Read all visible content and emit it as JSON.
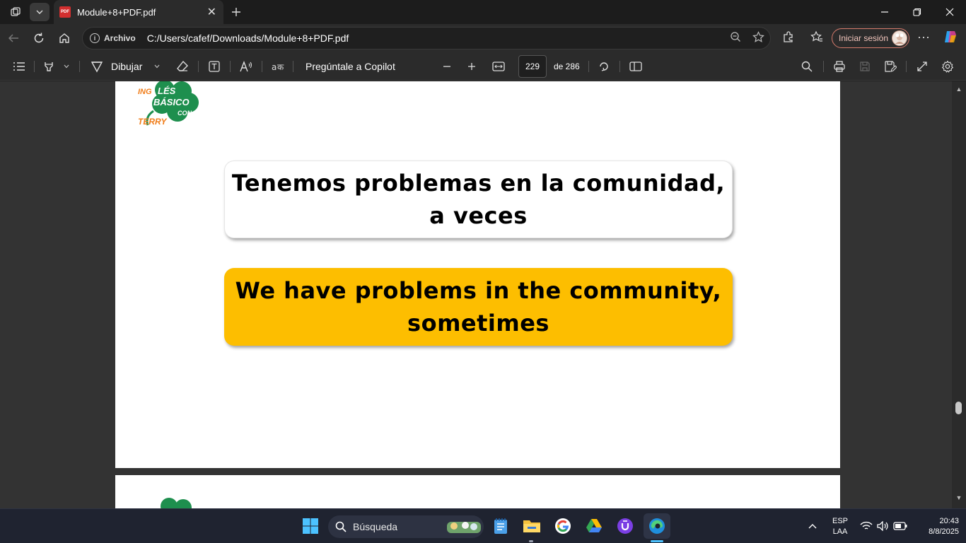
{
  "browser": {
    "tab_title": "Module+8+PDF.pdf",
    "address_chip": "Archivo",
    "url": "C:/Users/cafef/Downloads/Module+8+PDF.pdf",
    "signin_label": "Iniciar sesión"
  },
  "pdf_toolbar": {
    "draw_label": "Dibujar",
    "copilot_label": "Pregúntale a Copilot",
    "current_page": "229",
    "page_total": "de 286"
  },
  "document": {
    "logo": {
      "line1": "ING",
      "line2": "LÉS",
      "line3": "BÁSICO",
      "line4": "CON",
      "line5": "TERRY"
    },
    "spanish_line1": "Tenemos problemas en la comunidad,",
    "spanish_line2": "a veces",
    "english_line1": "We have problems in the community,",
    "english_line2": "sometimes"
  },
  "taskbar": {
    "search_placeholder": "Búsqueda",
    "lang_line1": "ESP",
    "lang_line2": "LAA",
    "time": "20:43",
    "date": "8/8/2025"
  },
  "colors": {
    "accent_yellow": "#fdbe00",
    "logo_green": "#1e8f4e",
    "logo_orange": "#f07d1a"
  }
}
